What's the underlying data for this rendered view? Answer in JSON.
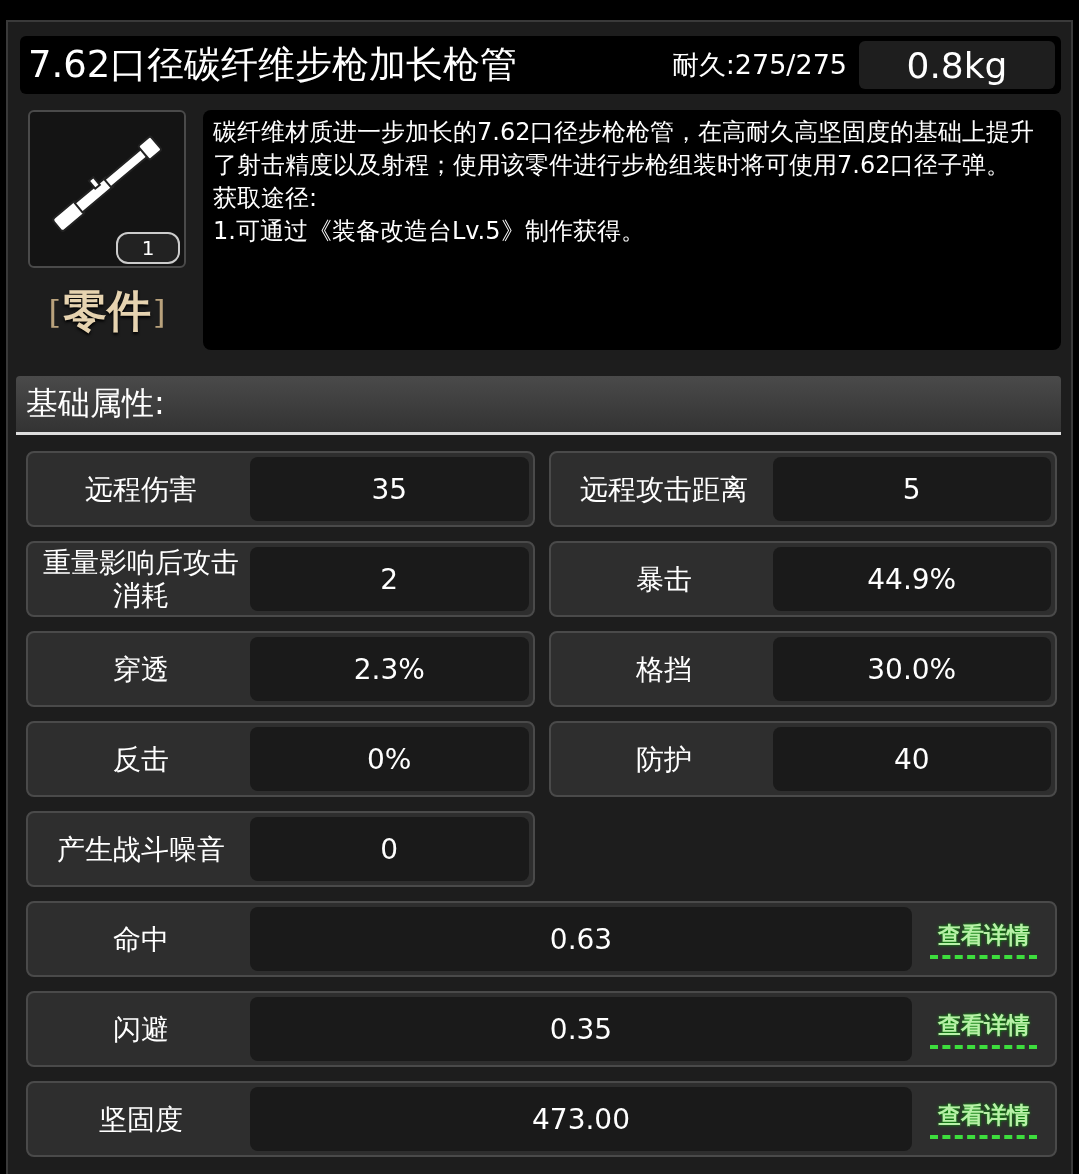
{
  "item": {
    "name": "7.62口径碳纤维步枪加长枪管",
    "durability": "耐久:275/275",
    "weight": "0.8kg",
    "count": "1",
    "category": "零件",
    "category_open": "[",
    "category_close": "]",
    "description": [
      "碳纤维材质进一步加长的7.62口径步枪枪管，在高耐久高坚固度的基础上提升了射击精度以及射程；使用该零件进行步枪组装时将可使用7.62口径子弹。",
      "获取途径:",
      "1.可通过《装备改造台Lv.5》制作获得。"
    ]
  },
  "section": {
    "title": "基础属性:"
  },
  "stats": [
    {
      "label": "远程伤害",
      "value": "35"
    },
    {
      "label": "远程攻击距离",
      "value": "5"
    },
    {
      "label": "重量影响后攻击消耗",
      "value": "2"
    },
    {
      "label": "暴击",
      "value": "44.9%"
    },
    {
      "label": "穿透",
      "value": "2.3%"
    },
    {
      "label": "格挡",
      "value": "30.0%"
    },
    {
      "label": "反击",
      "value": "0%"
    },
    {
      "label": "防护",
      "value": "40"
    },
    {
      "label": "产生战斗噪音",
      "value": "0"
    }
  ],
  "detail_stats": [
    {
      "label": "命中",
      "value": "0.63",
      "link": "查看详情"
    },
    {
      "label": "闪避",
      "value": "0.35",
      "link": "查看详情"
    },
    {
      "label": "坚固度",
      "value": "473.00",
      "link": "查看详情"
    }
  ]
}
